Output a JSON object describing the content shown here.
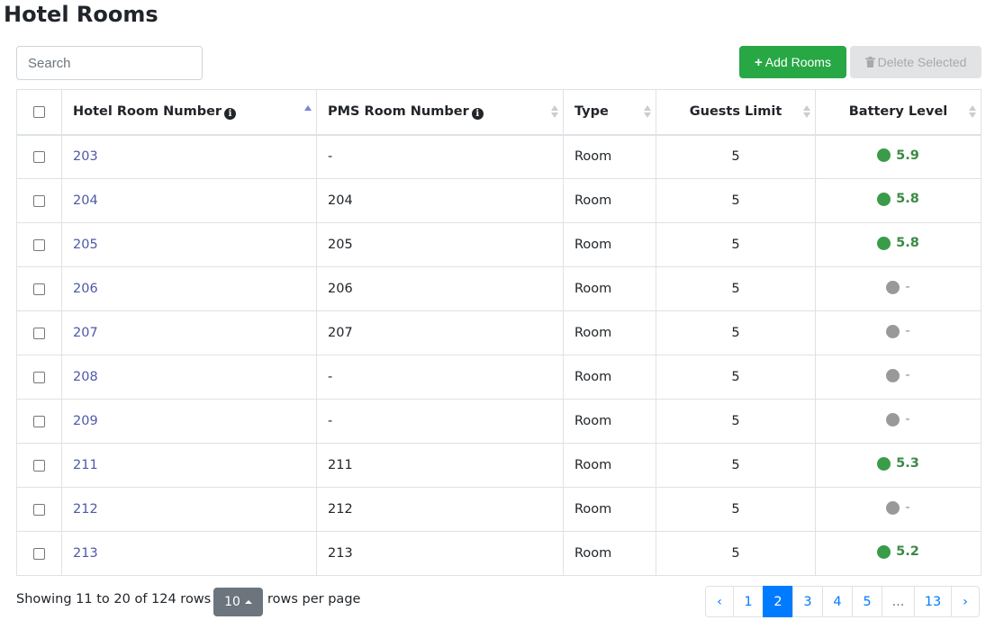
{
  "page": {
    "title": "Hotel Rooms"
  },
  "toolbar": {
    "search_placeholder": "Search",
    "add_label": "Add Rooms",
    "delete_label": "Delete Selected"
  },
  "table": {
    "headers": {
      "hotel_room_number": "Hotel Room Number",
      "pms_room_number": "PMS Room Number",
      "type": "Type",
      "guests_limit": "Guests Limit",
      "battery_level": "Battery Level"
    },
    "sort": {
      "column": "hotel_room_number",
      "direction": "asc"
    },
    "rows": [
      {
        "hotel": "203",
        "pms": "-",
        "type": "Room",
        "guests": "5",
        "battery": "5.9",
        "battery_status": "ok"
      },
      {
        "hotel": "204",
        "pms": "204",
        "type": "Room",
        "guests": "5",
        "battery": "5.8",
        "battery_status": "ok"
      },
      {
        "hotel": "205",
        "pms": "205",
        "type": "Room",
        "guests": "5",
        "battery": "5.8",
        "battery_status": "ok"
      },
      {
        "hotel": "206",
        "pms": "206",
        "type": "Room",
        "guests": "5",
        "battery": "-",
        "battery_status": "na"
      },
      {
        "hotel": "207",
        "pms": "207",
        "type": "Room",
        "guests": "5",
        "battery": "-",
        "battery_status": "na"
      },
      {
        "hotel": "208",
        "pms": "-",
        "type": "Room",
        "guests": "5",
        "battery": "-",
        "battery_status": "na"
      },
      {
        "hotel": "209",
        "pms": "-",
        "type": "Room",
        "guests": "5",
        "battery": "-",
        "battery_status": "na"
      },
      {
        "hotel": "211",
        "pms": "211",
        "type": "Room",
        "guests": "5",
        "battery": "5.3",
        "battery_status": "ok"
      },
      {
        "hotel": "212",
        "pms": "212",
        "type": "Room",
        "guests": "5",
        "battery": "-",
        "battery_status": "na"
      },
      {
        "hotel": "213",
        "pms": "213",
        "type": "Room",
        "guests": "5",
        "battery": "5.2",
        "battery_status": "ok"
      }
    ]
  },
  "footer": {
    "showing_text": "Showing 11 to 20 of 124 rows",
    "page_size": "10",
    "per_page_label": "rows per page"
  },
  "pagination": {
    "items": [
      {
        "label": "‹",
        "kind": "prev"
      },
      {
        "label": "1",
        "kind": "page"
      },
      {
        "label": "2",
        "kind": "page",
        "active": true
      },
      {
        "label": "3",
        "kind": "page"
      },
      {
        "label": "4",
        "kind": "page"
      },
      {
        "label": "5",
        "kind": "page"
      },
      {
        "label": "...",
        "kind": "gap"
      },
      {
        "label": "13",
        "kind": "page"
      },
      {
        "label": "›",
        "kind": "next"
      }
    ]
  },
  "colors": {
    "add_button": "#28a745",
    "delete_button_disabled": "#e2e3e5",
    "battery_ok": "#3a9b48",
    "battery_unknown": "#999999",
    "pagination_active": "#007bff",
    "link": "#4e58a8"
  },
  "icons": {
    "add": "plus-icon",
    "delete": "trash-icon",
    "info": "info-circle-icon",
    "sort": "sort-icon",
    "battery": "status-dot-icon"
  }
}
